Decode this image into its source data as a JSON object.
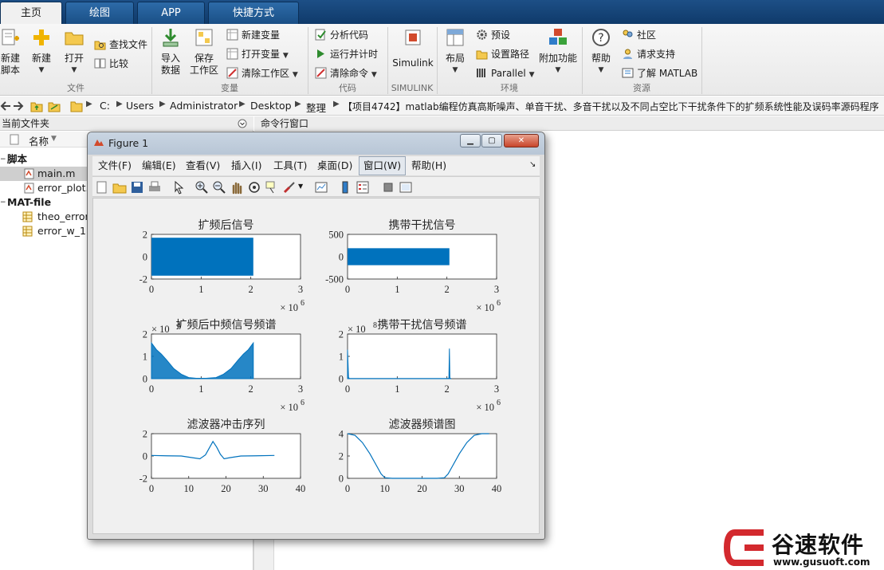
{
  "tabs": [
    "主页",
    "绘图",
    "APP",
    "快捷方式"
  ],
  "ribbon": {
    "file": {
      "label": "文件",
      "new_script": [
        "新建",
        "脚本"
      ],
      "new": "新建",
      "open": "打开",
      "find_files": "查找文件",
      "compare": "比较"
    },
    "variable": {
      "label": "变量",
      "import": [
        "导入",
        "数据"
      ],
      "save": [
        "保存",
        "工作区"
      ],
      "new_var": "新建变量",
      "open_var": "打开变量",
      "clear_ws": "清除工作区"
    },
    "code": {
      "label": "代码",
      "analyze": "分析代码",
      "run_time": "运行并计时",
      "clear_cmd": "清除命令"
    },
    "simulink": {
      "label": "SIMULINK",
      "btn": "Simulink"
    },
    "env": {
      "label": "环境",
      "layout": "布局",
      "prefs": "预设",
      "set_path": "设置路径",
      "parallel": "Parallel",
      "addons": "附加功能"
    },
    "resources": {
      "label": "资源",
      "help": "帮助",
      "community": "社区",
      "support": "请求支持",
      "learn": "了解 MATLAB"
    }
  },
  "address": {
    "parts": [
      "C:",
      "Users",
      "Administrator",
      "Desktop",
      "整理",
      "【项目4742】matlab编程仿真高斯噪声、单音干扰、多音干扰以及不同占空比下干扰条件下的扩频系统性能及误码率源码程序"
    ]
  },
  "file_panel": {
    "title": "当前文件夹",
    "column_name": "名称",
    "groups": [
      {
        "name": "脚本",
        "files": [
          "main.m",
          "error_plot."
        ]
      },
      {
        "name": "MAT-file",
        "files": [
          "theo_error",
          "error_w_1."
        ]
      }
    ]
  },
  "command_panel": {
    "title": "命令行窗口"
  },
  "figure": {
    "title": "Figure 1",
    "menus": [
      "文件(F)",
      "编辑(E)",
      "查看(V)",
      "插入(I)",
      "工具(T)",
      "桌面(D)",
      "窗口(W)",
      "帮助(H)"
    ]
  },
  "chart_data": [
    {
      "type": "area",
      "title": "扩频后信号",
      "x_exponent": "× 10^6",
      "xlim": [
        0,
        3
      ],
      "ylim": [
        -2,
        2
      ],
      "xticks": [
        "0",
        "1",
        "2",
        "3"
      ],
      "yticks": [
        "-2",
        "0",
        "2"
      ],
      "series": [
        {
          "x": [
            0,
            2.05
          ],
          "y_low": [
            -1.7,
            -1.7
          ],
          "y_high": [
            1.7,
            1.7
          ]
        }
      ],
      "color": "#0072BD"
    },
    {
      "type": "area",
      "title": "携带干扰信号",
      "x_exponent": "× 10^6",
      "xlim": [
        0,
        3
      ],
      "ylim": [
        -500,
        500
      ],
      "xticks": [
        "0",
        "1",
        "2",
        "3"
      ],
      "yticks": [
        "-500",
        "0",
        "500"
      ],
      "series": [
        {
          "x": [
            0,
            2.05
          ],
          "y_low": [
            -190,
            -190
          ],
          "y_high": [
            190,
            190
          ]
        }
      ],
      "color": "#0072BD"
    },
    {
      "type": "line",
      "title": "扩频后中频信号频谱",
      "x_exponent": "× 10^6",
      "y_exponent": "× 10^4",
      "xlim": [
        0,
        3
      ],
      "ylim": [
        0,
        2
      ],
      "xticks": [
        "0",
        "1",
        "2",
        "3"
      ],
      "yticks": [
        "0",
        "1",
        "2"
      ],
      "series": [
        {
          "x": [
            0,
            0.1,
            0.2,
            0.3,
            0.45,
            0.6,
            0.75,
            0.9,
            1.1,
            1.3,
            1.45,
            1.6,
            1.75,
            1.85,
            1.95,
            2.05
          ],
          "y": [
            1.6,
            1.3,
            1.1,
            0.85,
            0.45,
            0.2,
            0.05,
            0.02,
            0.02,
            0.05,
            0.2,
            0.45,
            0.85,
            1.1,
            1.3,
            1.6
          ]
        }
      ],
      "color": "#0072BD"
    },
    {
      "type": "line",
      "title": "携带干扰信号频谱",
      "x_exponent": "× 10^6",
      "y_exponent": "× 10^8",
      "xlim": [
        0,
        3
      ],
      "ylim": [
        0,
        2
      ],
      "xticks": [
        "0",
        "1",
        "2",
        "3"
      ],
      "yticks": [
        "0",
        "1",
        "2"
      ],
      "series": [
        {
          "x": [
            0,
            0.02,
            0.04,
            2.0,
            2.04,
            2.05,
            2.06,
            2.08
          ],
          "y": [
            1.3,
            0.05,
            0.01,
            0.01,
            0.02,
            1.35,
            0.02,
            0.01
          ]
        }
      ],
      "color": "#0072BD"
    },
    {
      "type": "line",
      "title": "滤波器冲击序列",
      "xlim": [
        0,
        40
      ],
      "ylim": [
        -2,
        2
      ],
      "xticks": [
        "0",
        "10",
        "20",
        "30",
        "40"
      ],
      "yticks": [
        "-2",
        "0",
        "2"
      ],
      "series": [
        {
          "x": [
            0,
            4,
            8,
            11,
            13,
            14.5,
            15.5,
            16.5,
            17.5,
            18.5,
            19.5,
            21,
            24,
            28,
            33
          ],
          "y": [
            0.05,
            0.02,
            0,
            -0.15,
            -0.25,
            0.1,
            0.7,
            1.3,
            0.8,
            0.15,
            -0.25,
            -0.15,
            0,
            0.02,
            0.05
          ]
        }
      ],
      "color": "#0072BD"
    },
    {
      "type": "line",
      "title": "滤波器频谱图",
      "xlim": [
        0,
        40
      ],
      "ylim": [
        0,
        4
      ],
      "xticks": [
        "0",
        "10",
        "20",
        "30",
        "40"
      ],
      "yticks": [
        "0",
        "2",
        "4"
      ],
      "series": [
        {
          "x": [
            0,
            2,
            4,
            6,
            8,
            9,
            10,
            12,
            16,
            20,
            24,
            26,
            27,
            28,
            30,
            32,
            34,
            36,
            38
          ],
          "y": [
            4.0,
            3.85,
            3.2,
            2.2,
            1.0,
            0.4,
            0.05,
            0,
            0,
            0,
            0,
            0.05,
            0.4,
            1.0,
            2.2,
            3.2,
            3.85,
            4.0,
            4.0
          ]
        }
      ],
      "color": "#0072BD"
    }
  ],
  "watermark": {
    "brand": "谷速软件",
    "url": "www.gusuoft.com"
  },
  "colors": {
    "matlab_blue": "#0072BD",
    "tab_bar": "#1d4f86",
    "watermark_red": "#d3292e"
  }
}
